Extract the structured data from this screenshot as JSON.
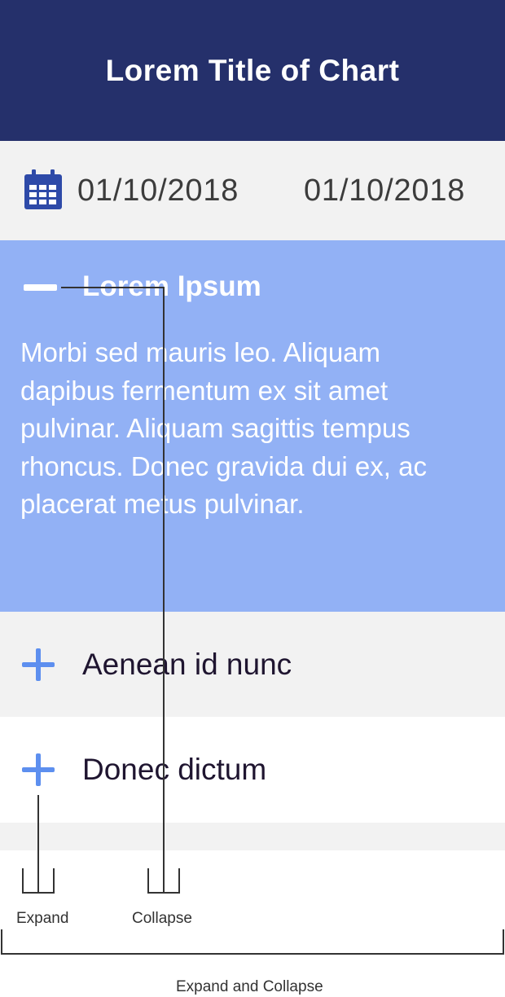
{
  "header": {
    "title": "Lorem Title of Chart"
  },
  "date_range": {
    "start": "01/10/2018",
    "end": "01/10/2018",
    "icon": "calendar-icon"
  },
  "accordion": {
    "open_item": {
      "title": "Lorem Ipsum",
      "icon": "minus-icon",
      "body": "Morbi sed mauris leo. Aliquam dapibus fermentum ex sit amet pulvinar. Aliquam sagittis tempus rhoncus. Donec gravida dui ex, ac placerat metus pulvinar."
    },
    "items": [
      {
        "label": "Aenean id nunc",
        "icon": "plus-icon"
      },
      {
        "label": "Donec dictum",
        "icon": "plus-icon"
      }
    ]
  },
  "annotations": {
    "expand": "Expand",
    "collapse": "Collapse",
    "expand_and_collapse": "Expand and Collapse"
  },
  "colors": {
    "header_bg": "#25306b",
    "open_bg": "#92b1f5",
    "row_bg_alt": "#f2f2f2",
    "plus_icon": "#5d8fef",
    "calendar_icon": "#2e4aa8"
  }
}
